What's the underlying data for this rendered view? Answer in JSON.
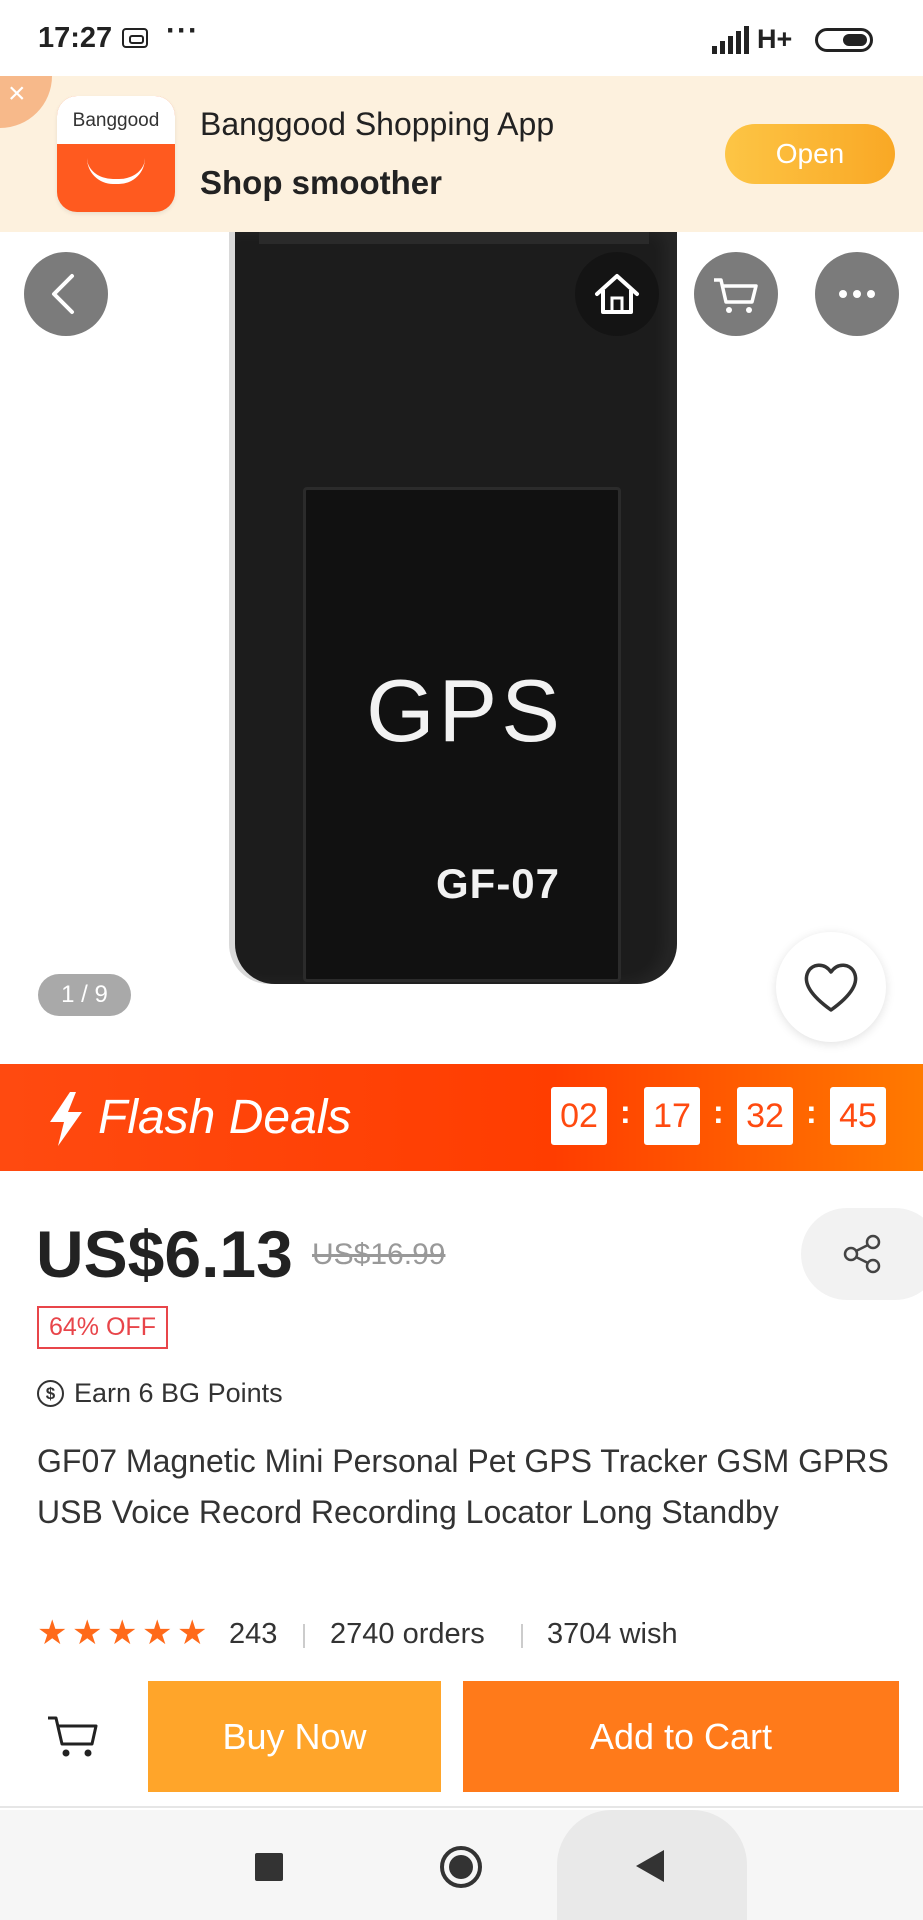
{
  "status_bar": {
    "time": "17:27",
    "dots": "···",
    "network": "H+"
  },
  "app_banner": {
    "logo_text": "Banggood",
    "title": "Banggood Shopping App",
    "subtitle": "Shop smoother",
    "open_label": "Open",
    "close_symbol": "×"
  },
  "gallery": {
    "product_label_big": "GPS",
    "product_label_model": "GF-07",
    "image_counter": "1 / 9",
    "icons": [
      "back-icon",
      "home-icon",
      "cart-icon",
      "more-icon",
      "heart-icon"
    ]
  },
  "flash_deals": {
    "title": "Flash Deals",
    "timer": {
      "hours": "02",
      "minutes": "17",
      "seconds": "32",
      "centiseconds": "45",
      "separator": ":"
    }
  },
  "product": {
    "price": "US$6.13",
    "original_price": "US$16.99",
    "discount": "64% OFF",
    "points_icon": "$",
    "points": "Earn 6 BG Points",
    "title": "GF07 Magnetic Mini Personal Pet GPS Tracker GSM GPRS USB Voice Record Recording Locator Long Standby",
    "rating": {
      "stars": 5,
      "star_glyph": "★",
      "reviews": "243",
      "orders": "2740 orders",
      "wish": "3704 wish"
    }
  },
  "actions": {
    "buy_now": "Buy Now",
    "add_to_cart": "Add to Cart"
  },
  "colors": {
    "accent_orange": "#ff7a1a",
    "buy_now_orange": "#ffa52a",
    "flash_red": "#ff4a10",
    "discount_red": "#e8454a",
    "banner_bg": "#fdf1de"
  }
}
